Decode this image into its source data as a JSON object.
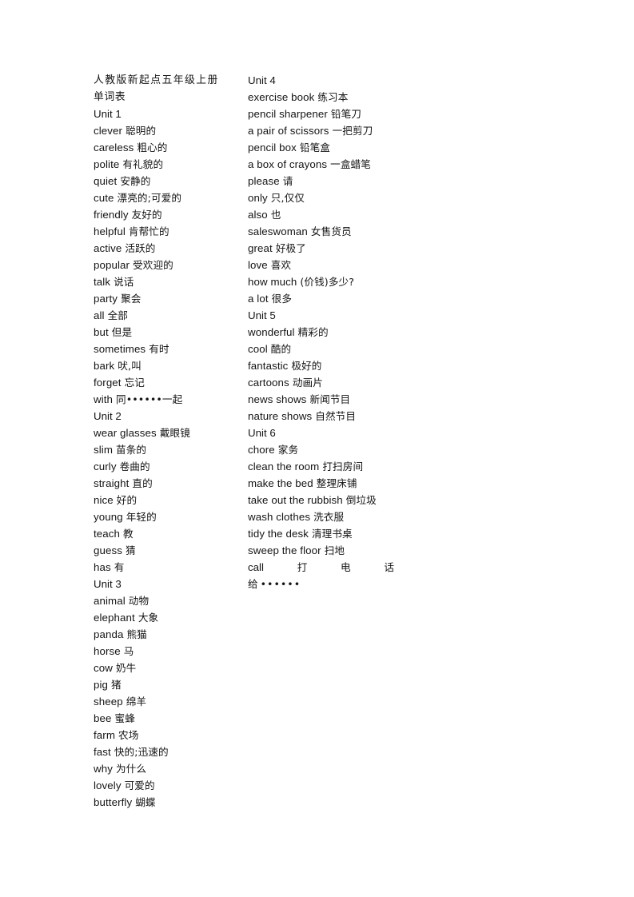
{
  "document": {
    "title_lines": [
      "人教版新起点五年级上册",
      "单词表"
    ]
  },
  "left_column": [
    {
      "type": "unit",
      "text": "Unit 1"
    },
    {
      "type": "entry",
      "en": "clever",
      "zh": "聪明的"
    },
    {
      "type": "entry",
      "en": "careless",
      "zh": "粗心的"
    },
    {
      "type": "entry",
      "en": "polite",
      "zh": "有礼貌的"
    },
    {
      "type": "entry",
      "en": "quiet",
      "zh": "安静的"
    },
    {
      "type": "entry",
      "en": "cute",
      "zh": "漂亮的;可爱的"
    },
    {
      "type": "entry",
      "en": "friendly",
      "zh": "友好的"
    },
    {
      "type": "entry",
      "en": "helpful",
      "zh": "肯帮忙的"
    },
    {
      "type": "entry",
      "en": "active",
      "zh": "活跃的"
    },
    {
      "type": "entry",
      "en": "popular",
      "zh": "受欢迎的"
    },
    {
      "type": "entry",
      "en": "talk",
      "zh": "说话"
    },
    {
      "type": "entry",
      "en": "party",
      "zh": "聚会"
    },
    {
      "type": "entry",
      "en": "all",
      "zh": "全部"
    },
    {
      "type": "entry",
      "en": "but",
      "zh": "但是"
    },
    {
      "type": "entry",
      "en": "sometimes",
      "zh": "有时"
    },
    {
      "type": "entry",
      "en": "bark",
      "zh": "吠,叫"
    },
    {
      "type": "entry",
      "en": "forget",
      "zh": "忘记"
    },
    {
      "type": "entry",
      "en": "with",
      "zh": "同••••••一起"
    },
    {
      "type": "unit",
      "text": "Unit 2"
    },
    {
      "type": "entry",
      "en": "wear glasses",
      "zh": "戴眼镜"
    },
    {
      "type": "entry",
      "en": "slim",
      "zh": "苗条的"
    },
    {
      "type": "entry",
      "en": "curly",
      "zh": "卷曲的"
    },
    {
      "type": "entry",
      "en": "straight",
      "zh": "直的"
    },
    {
      "type": "entry",
      "en": "nice",
      "zh": "好的"
    },
    {
      "type": "entry",
      "en": "young",
      "zh": "年轻的"
    },
    {
      "type": "entry",
      "en": "teach",
      "zh": "教"
    },
    {
      "type": "entry",
      "en": "guess",
      "zh": "猜"
    },
    {
      "type": "entry",
      "en": "has",
      "zh": "有"
    },
    {
      "type": "unit",
      "text": "Unit 3"
    },
    {
      "type": "entry",
      "en": "animal",
      "zh": "动物"
    },
    {
      "type": "entry",
      "en": "elephant",
      "zh": "大象"
    },
    {
      "type": "entry",
      "en": "panda",
      "zh": "熊猫"
    },
    {
      "type": "entry",
      "en": "horse",
      "zh": "马"
    },
    {
      "type": "entry",
      "en": "cow",
      "zh": "奶牛"
    },
    {
      "type": "entry",
      "en": "pig",
      "zh": "猪"
    },
    {
      "type": "entry",
      "en": "sheep",
      "zh": "绵羊"
    },
    {
      "type": "entry",
      "en": "bee",
      "zh": "蜜蜂"
    },
    {
      "type": "entry",
      "en": "farm",
      "zh": "农场"
    },
    {
      "type": "entry",
      "en": "fast",
      "zh": "快的;迅速的"
    },
    {
      "type": "entry",
      "en": "why",
      "zh": "为什么"
    },
    {
      "type": "entry",
      "en": "lovely",
      "zh": "可爱的"
    },
    {
      "type": "entry",
      "en": "butterfly",
      "zh": "蝴蝶"
    }
  ],
  "right_column": [
    {
      "type": "unit",
      "text": "Unit 4"
    },
    {
      "type": "entry",
      "en": "exercise book",
      "zh": "练习本"
    },
    {
      "type": "entry",
      "en": "pencil sharpener",
      "zh": "铅笔刀"
    },
    {
      "type": "entry",
      "en": "a pair of scissors",
      "zh": "一把剪刀"
    },
    {
      "type": "entry",
      "en": "pencil box",
      "zh": "铅笔盒"
    },
    {
      "type": "entry",
      "en": "a box of crayons",
      "zh": "一盒蜡笔"
    },
    {
      "type": "entry",
      "en": "please",
      "zh": "请"
    },
    {
      "type": "entry",
      "en": "only",
      "zh": "只,仅仅"
    },
    {
      "type": "entry",
      "en": "also",
      "zh": "也"
    },
    {
      "type": "entry",
      "en": "saleswoman",
      "zh": "女售货员"
    },
    {
      "type": "entry",
      "en": "great",
      "zh": "好极了"
    },
    {
      "type": "entry",
      "en": "love",
      "zh": "喜欢"
    },
    {
      "type": "entry",
      "en": "how much",
      "zh": "(价钱)多少?"
    },
    {
      "type": "entry",
      "en": "a lot",
      "zh": "很多"
    },
    {
      "type": "unit",
      "text": "Unit 5"
    },
    {
      "type": "entry",
      "en": "wonderful",
      "zh": "精彩的"
    },
    {
      "type": "entry",
      "en": "cool",
      "zh": "酷的"
    },
    {
      "type": "entry",
      "en": "fantastic",
      "zh": "极好的"
    },
    {
      "type": "entry",
      "en": "cartoons",
      "zh": "动画片"
    },
    {
      "type": "entry",
      "en": "news shows",
      "zh": "新闻节目"
    },
    {
      "type": "entry",
      "en": "nature shows",
      "zh": "自然节目"
    },
    {
      "type": "unit",
      "text": "Unit 6"
    },
    {
      "type": "entry",
      "en": "chore",
      "zh": "家务"
    },
    {
      "type": "entry",
      "en": "clean the room",
      "zh": "打扫房间"
    },
    {
      "type": "entry",
      "en": "make the bed",
      "zh": "整理床铺"
    },
    {
      "type": "entry",
      "en": "take out the rubbish",
      "zh": "倒垃圾"
    },
    {
      "type": "entry",
      "en": "wash clothes",
      "zh": "洗衣服"
    },
    {
      "type": "entry",
      "en": "tidy the desk",
      "zh": "清理书桌"
    },
    {
      "type": "entry",
      "en": "sweep the floor",
      "zh": "扫地"
    }
  ],
  "right_column_tail": {
    "justified_parts": [
      "call",
      "打",
      "电",
      "话"
    ],
    "ellipsis_prefix": "给",
    "ellipsis_dots": "••••••"
  }
}
